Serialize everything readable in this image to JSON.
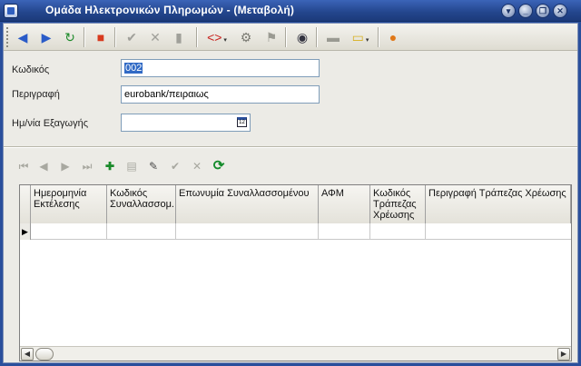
{
  "window": {
    "title": "Ομάδα Ηλεκτρονικών Πληρωμών - (Μεταβολή)"
  },
  "title_buttons": [
    "▾",
    "_",
    "❐",
    "✕"
  ],
  "toolbar": {
    "buttons": [
      {
        "name": "back-icon",
        "glyph": "◀",
        "color": "#2a5bc8"
      },
      {
        "name": "forward-icon",
        "glyph": "▶",
        "color": "#2a5bc8"
      },
      {
        "name": "refresh-icon",
        "glyph": "↻",
        "color": "#1d8a2a"
      },
      {
        "name": "stop-icon",
        "glyph": "■",
        "color": "#d83a1e"
      },
      {
        "name": "confirm-icon",
        "glyph": "✔",
        "color": "#a0a09a"
      },
      {
        "name": "cancel-icon",
        "glyph": "✕",
        "color": "#a0a09a"
      },
      {
        "name": "delete-icon",
        "glyph": "▮",
        "color": "#a0a09a"
      },
      {
        "name": "code-icon",
        "glyph": "<>",
        "color": "#c8201c"
      },
      {
        "name": "gear-icon",
        "glyph": "⚙",
        "color": "#7a7a72"
      },
      {
        "name": "users-icon",
        "glyph": "⚑",
        "color": "#9a9a92"
      },
      {
        "name": "binoculars-icon",
        "glyph": "◉",
        "color": "#333340"
      },
      {
        "name": "folder-icon",
        "glyph": "▬",
        "color": "#9a9a92"
      },
      {
        "name": "note-icon",
        "glyph": "▭",
        "color": "#d8b020"
      },
      {
        "name": "user-settings-icon",
        "glyph": "●",
        "color": "#e07818"
      }
    ]
  },
  "form": {
    "code_label": "Κωδικός",
    "code_value": "002",
    "description_label": "Περιγραφή",
    "description_value": "eurobank/πειραιως",
    "export_date_label": "Ημ/νία Εξαγωγής",
    "export_date_value": "",
    "calendar_icon_text": "12"
  },
  "navigator": {
    "buttons": [
      {
        "name": "first-record-icon",
        "glyph": "⏮",
        "color": "#a8a8a0"
      },
      {
        "name": "prev-record-icon",
        "glyph": "◀",
        "color": "#a8a8a0"
      },
      {
        "name": "next-record-icon",
        "glyph": "▶",
        "color": "#a8a8a0"
      },
      {
        "name": "last-record-icon",
        "glyph": "⏭",
        "color": "#a8a8a0"
      },
      {
        "name": "add-record-icon",
        "glyph": "✚",
        "color": "#1a8a2a"
      },
      {
        "name": "delete-record-icon",
        "glyph": "▤",
        "color": "#a8a8a0"
      },
      {
        "name": "edit-record-icon",
        "glyph": "✎",
        "color": "#4a4a4a"
      },
      {
        "name": "post-record-icon",
        "glyph": "✔",
        "color": "#a8a8a0"
      },
      {
        "name": "cancel-record-icon",
        "glyph": "✕",
        "color": "#a8a8a0"
      },
      {
        "name": "refresh-records-icon",
        "glyph": "⟳",
        "color": "#138a2a"
      }
    ]
  },
  "grid": {
    "columns": [
      "Ημερομηνία Εκτέλεσης",
      "Κωδικός Συναλλασσομ..",
      "Επωνυμία Συναλλασσομένου",
      "ΑΦΜ",
      "Κωδικός Τράπεζας Χρέωσης",
      "Περιγραφή Τράπεζας Χρέωσης"
    ],
    "row_indicator": "▶"
  },
  "scrollbar": {
    "left_arrow": "◀",
    "right_arrow": "▶"
  }
}
